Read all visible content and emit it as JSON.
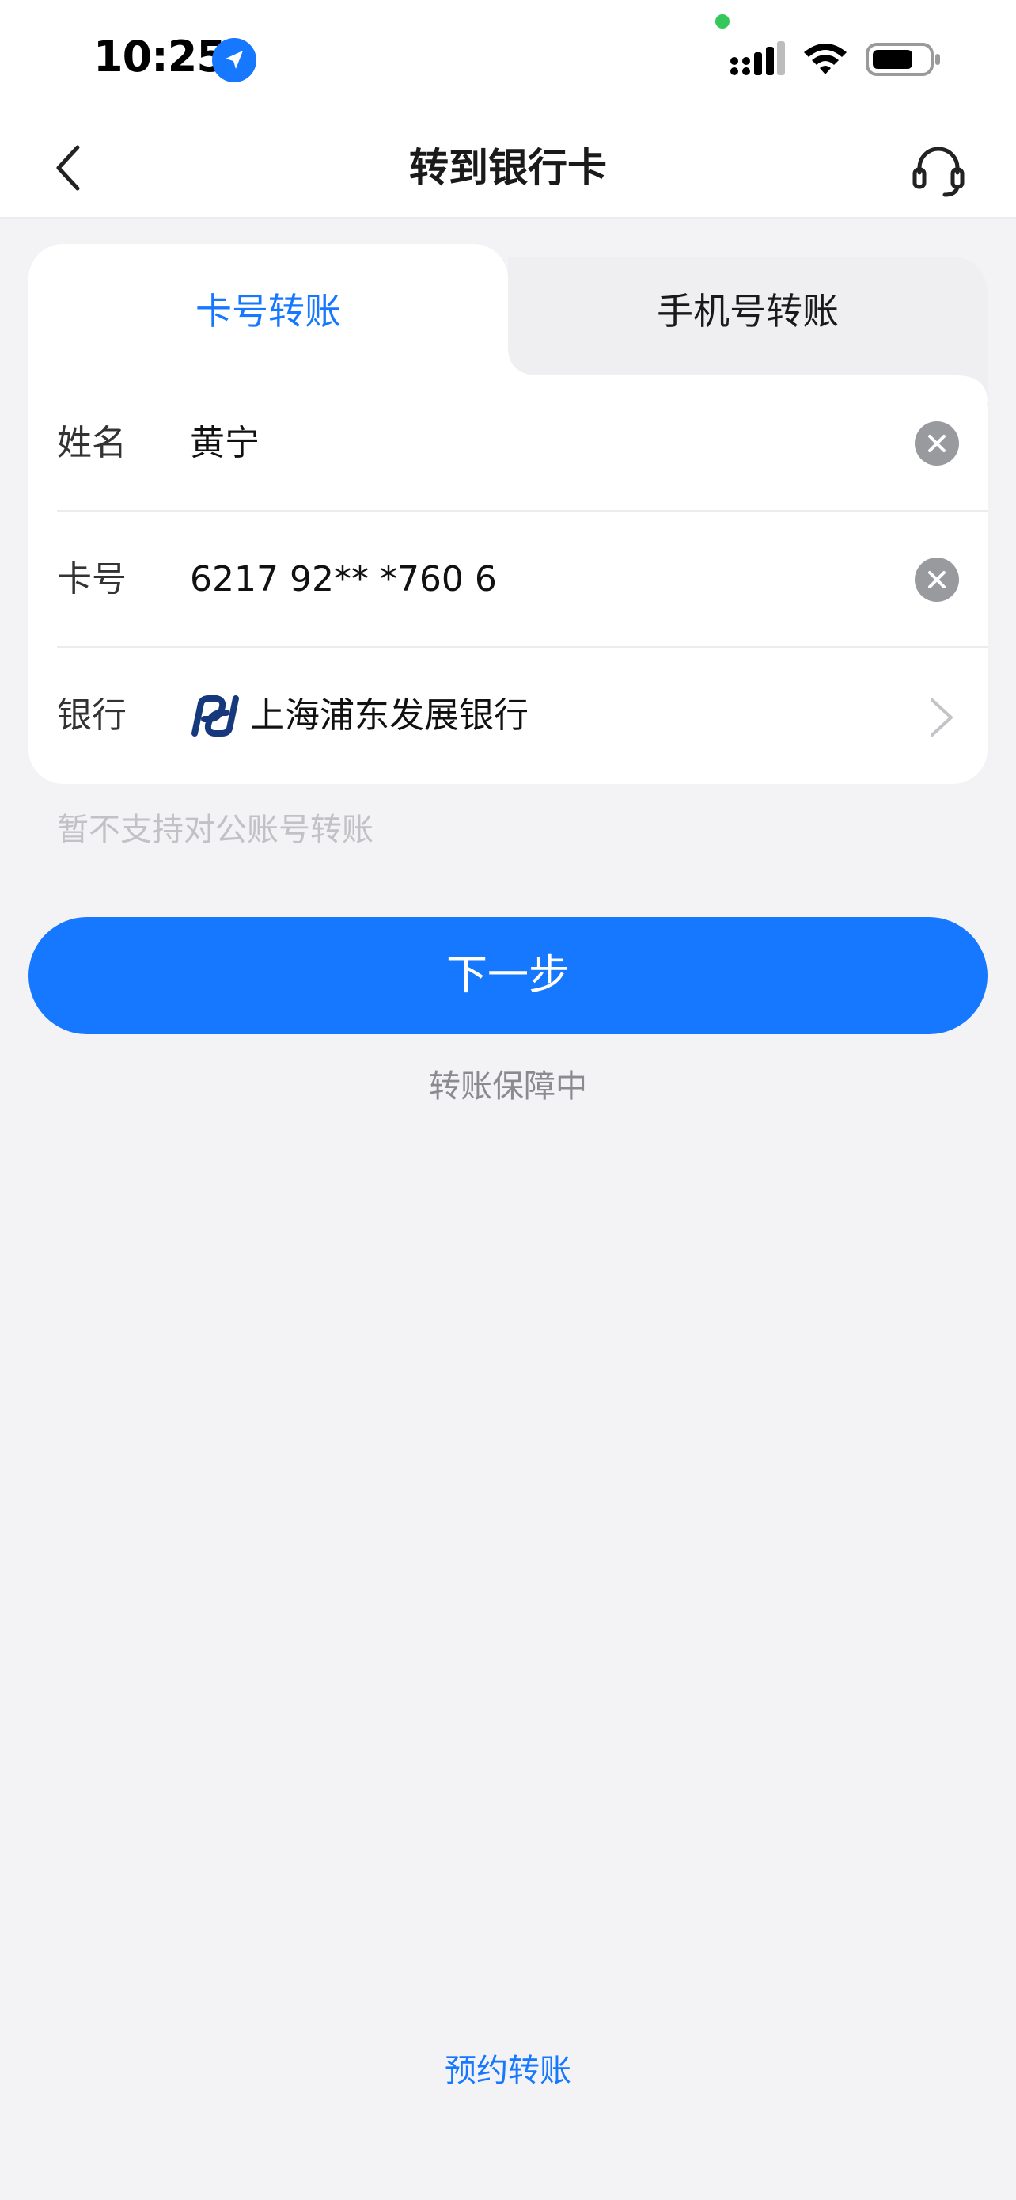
{
  "status_bar": {
    "time": "10:25"
  },
  "nav": {
    "title": "转到银行卡"
  },
  "tabs": [
    {
      "label": "卡号转账",
      "active": true
    },
    {
      "label": "手机号转账",
      "active": false
    }
  ],
  "form": {
    "name": {
      "label": "姓名",
      "value": "黄宁"
    },
    "card": {
      "label": "卡号",
      "value": "6217 92** *760 6"
    },
    "bank": {
      "label": "银行",
      "value": "上海浦东发展银行"
    }
  },
  "hint": "暂不支持对公账号转账",
  "next_label": "下一步",
  "guarantee": "转账保障中",
  "schedule_label": "预约转账",
  "colors": {
    "accent": "#1677ff",
    "background": "#f3f3f5",
    "bank_logo": "#16387c",
    "camera_dot": "#34c759"
  },
  "icons": {
    "back": "chevron-left-icon",
    "support": "headset-icon",
    "clear": "close-circle-icon",
    "bank": "spd-bank-logo-icon",
    "bank_select": "chevron-right-icon"
  }
}
